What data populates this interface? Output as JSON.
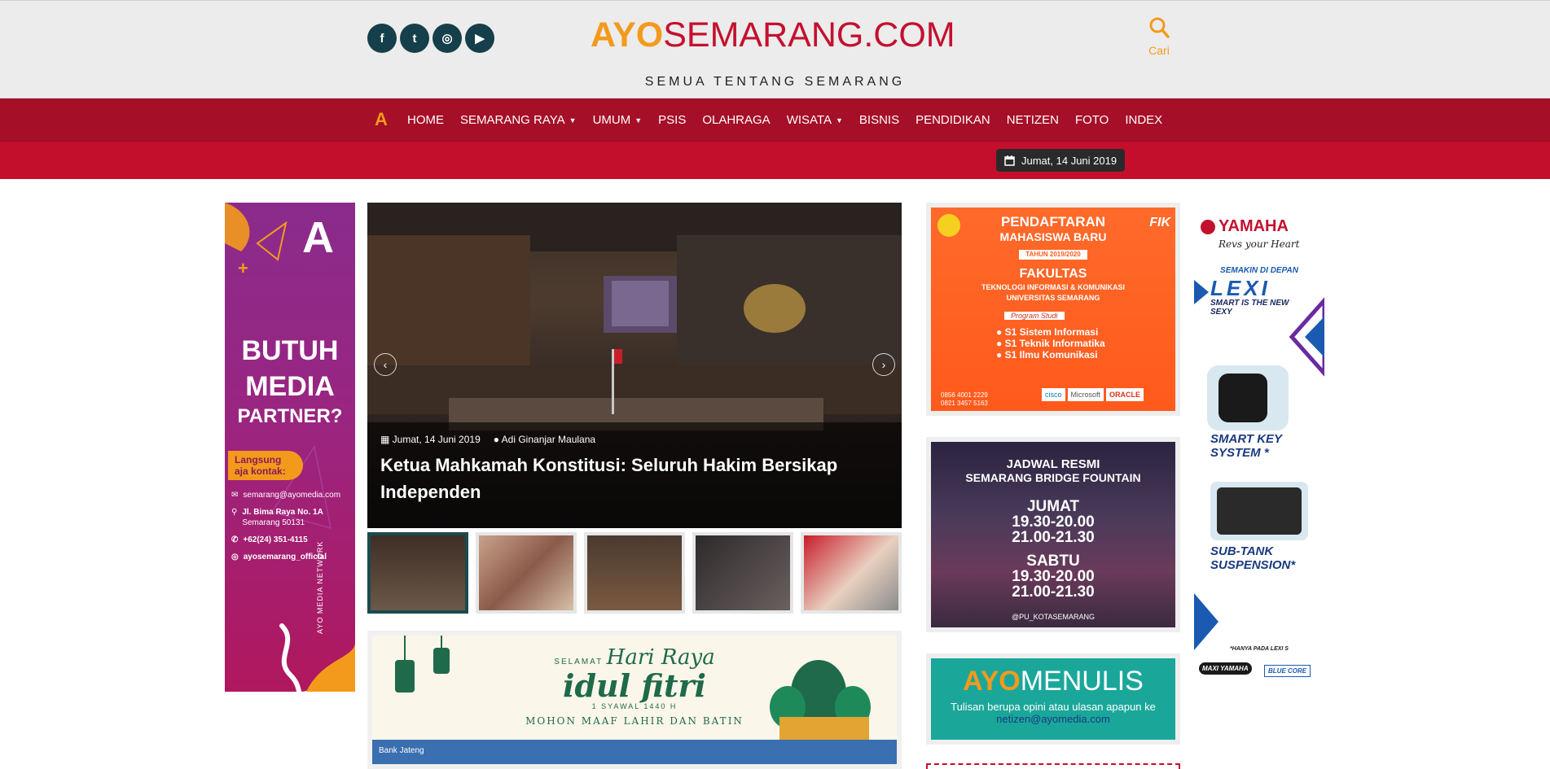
{
  "header": {
    "logo_ayo": "AYO",
    "logo_rest": "SEMARANG.COM",
    "tagline": "SEMUA TENTANG SEMARANG",
    "search_label": "Cari",
    "social": [
      {
        "name": "facebook-icon",
        "glyph": "f"
      },
      {
        "name": "twitter-icon",
        "glyph": "t"
      },
      {
        "name": "instagram-icon",
        "glyph": "◎"
      },
      {
        "name": "youtube-icon",
        "glyph": "▶"
      }
    ]
  },
  "nav": {
    "logo_glyph": "A",
    "items": [
      {
        "label": "HOME",
        "dropdown": false
      },
      {
        "label": "SEMARANG RAYA",
        "dropdown": true
      },
      {
        "label": "UMUM",
        "dropdown": true
      },
      {
        "label": "PSIS",
        "dropdown": false
      },
      {
        "label": "OLAHRAGA",
        "dropdown": false
      },
      {
        "label": "WISATA",
        "dropdown": true
      },
      {
        "label": "BISNIS",
        "dropdown": false
      },
      {
        "label": "PENDIDIKAN",
        "dropdown": false
      },
      {
        "label": "NETIZEN",
        "dropdown": false
      },
      {
        "label": "FOTO",
        "dropdown": false
      },
      {
        "label": "INDEX",
        "dropdown": false
      }
    ]
  },
  "date_label": "Jumat, 14 Juni 2019",
  "ad_left": {
    "headline1": "BUTUH",
    "headline2": "MEDIA",
    "headline3": "PARTNER?",
    "contact_cta": "Langsung aja kontak:",
    "email": "semarang@ayomedia.com",
    "address1": "Jl. Bima Raya No. 1A",
    "address2": "Semarang 50131",
    "phone": "+62(24) 351-4115",
    "instagram": "ayosemarang_official",
    "network": "AYO MEDIA NETWORK"
  },
  "slider": {
    "date": "Jumat, 14 Juni 2019",
    "author": "Adi Ginanjar Maulana",
    "headline": "Ketua Mahkamah Konstitusi: Seluruh Hakim Bersikap Independen",
    "prev_icon": "‹",
    "next_icon": "›"
  },
  "eid_banner": {
    "greeting": "SELAMAT",
    "script1": "Hari Raya",
    "script2": "idul fitri",
    "date": "1 SYAWAL 1440 H",
    "message": "MOHON MAAF LAHIR DAN BATIN",
    "sponsor": "Bank Jateng"
  },
  "ad_fti": {
    "title1": "PENDAFTARAN",
    "title2": "MAHASISWA BARU",
    "year": "TAHUN 2019/2020",
    "faculty": "FAKULTAS",
    "faculty_name": "TEKNOLOGI INFORMASI & KOMUNIKASI",
    "univ": "UNIVERSITAS SEMARANG",
    "program_title": "Program Studi",
    "programs": [
      "S1 Sistem Informasi",
      "S1 Teknik Informatika",
      "S1 Ilmu Komunikasi"
    ],
    "phone1": "0856 4001 2229",
    "phone2": "0821 3457 5163",
    "partners": [
      "cisco",
      "Microsoft",
      "ORACLE"
    ]
  },
  "ad_fountain": {
    "title1": "JADWAL RESMI",
    "title2": "SEMARANG BRIDGE FOUNTAIN",
    "day1": "JUMAT",
    "day1_time1": "19.30-20.00",
    "day1_time2": "21.00-21.30",
    "day2": "SABTU",
    "day2_time1": "19.30-20.00",
    "day2_time2": "21.00-21.30",
    "handle": "@PU_KOTASEMARANG"
  },
  "ad_menulis": {
    "ayo": "AYO",
    "menulis": "MENULIS",
    "line1": "Tulisan berupa opini atau ulasan apapun ke",
    "email": "netizen@ayomedia.com"
  },
  "ad_yamaha": {
    "brand": "YAMAHA",
    "slogan": "Revs your Heart",
    "sub": "SEMAKIN DI DEPAN",
    "model": "LEXI",
    "tagline": "SMART IS THE NEW SEXY",
    "feature1": "SMART KEY SYSTEM *",
    "feature2": "SUB-TANK SUSPENSION*",
    "footnote": "*HANYA PADA LEXI S",
    "logo1": "MAXI YAMAHA",
    "logo2": "BLUE CORE"
  },
  "colors": {
    "nav": "#a50f27",
    "subbar": "#c40f2c",
    "brand_orange": "#f39a1c",
    "brand_red": "#c4102f",
    "social": "#153f4a"
  }
}
